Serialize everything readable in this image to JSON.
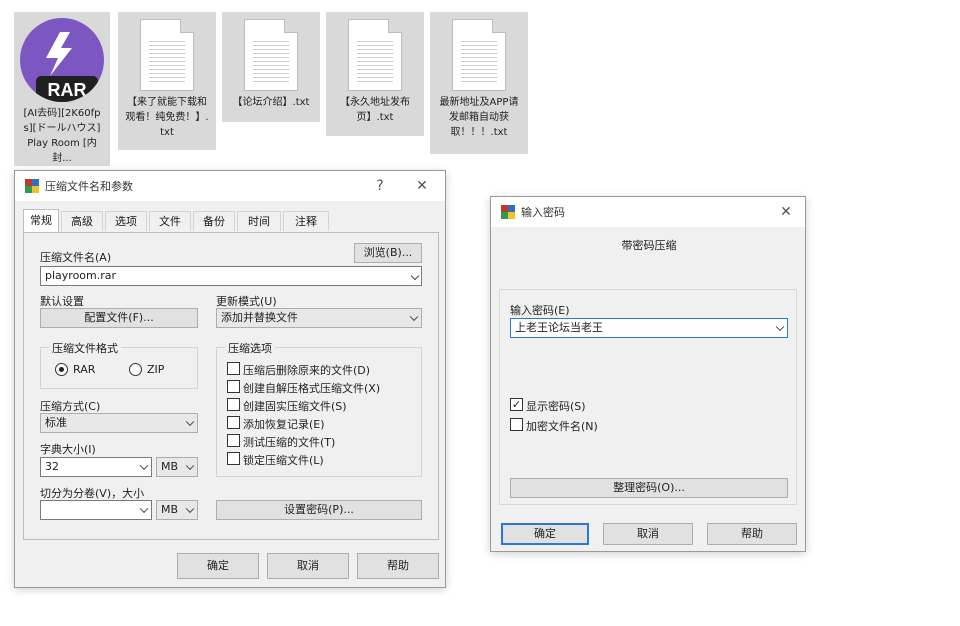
{
  "desktop": {
    "files": [
      {
        "name": "[AI去码][2K60fps][ドールハウス] Play Room [内封...",
        "type": "rar",
        "badge": "RAR"
      },
      {
        "name": "【来了就能下载和观看！纯免费！】.txt",
        "type": "txt"
      },
      {
        "name": "【论坛介绍】.txt",
        "type": "txt"
      },
      {
        "name": "【永久地址发布页】.txt",
        "type": "txt"
      },
      {
        "name": "最新地址及APP请发邮箱自动获取！！！.txt",
        "type": "txt"
      }
    ]
  },
  "archive_dialog": {
    "title": "压缩文件名和参数",
    "help_glyph": "?",
    "close_glyph": "✕",
    "tabs": [
      "常规",
      "高级",
      "选项",
      "文件",
      "备份",
      "时间",
      "注释"
    ],
    "active_tab": "常规",
    "archive_name_label": "压缩文件名(A)",
    "browse_button": "浏览(B)...",
    "archive_name_value": "playroom.rar",
    "default_settings_label": "默认设置",
    "profiles_button": "配置文件(F)...",
    "update_mode_label": "更新模式(U)",
    "update_mode_value": "添加并替换文件",
    "format_group_title": "压缩文件格式",
    "format_rar": "RAR",
    "format_zip": "ZIP",
    "selected_format": "RAR",
    "options_group_title": "压缩选项",
    "options": [
      {
        "label": "压缩后删除原来的文件(D)",
        "checked": false
      },
      {
        "label": "创建自解压格式压缩文件(X)",
        "checked": false
      },
      {
        "label": "创建固实压缩文件(S)",
        "checked": false
      },
      {
        "label": "添加恢复记录(E)",
        "checked": false
      },
      {
        "label": "测试压缩的文件(T)",
        "checked": false
      },
      {
        "label": "锁定压缩文件(L)",
        "checked": false
      }
    ],
    "method_label": "压缩方式(C)",
    "method_value": "标准",
    "dict_label": "字典大小(I)",
    "dict_value": "32",
    "dict_unit": "MB",
    "split_label": "切分为分卷(V)，大小",
    "split_value": "",
    "split_unit": "MB",
    "set_password_button": "设置密码(P)...",
    "ok_button": "确定",
    "cancel_button": "取消",
    "help_button": "帮助"
  },
  "password_dialog": {
    "title": "输入密码",
    "close_glyph": "✕",
    "heading": "带密码压缩",
    "password_label": "输入密码(E)",
    "password_value": "上老王论坛当老王",
    "show_password_label": "显示密码(S)",
    "show_password_checked": true,
    "encrypt_names_label": "加密文件名(N)",
    "encrypt_names_checked": false,
    "organize_button": "整理密码(O)...",
    "ok_button": "确定",
    "cancel_button": "取消",
    "help_button": "帮助"
  },
  "colors": {
    "rar_purple": "#7d57c1",
    "focus_blue": "#2d78d6"
  }
}
